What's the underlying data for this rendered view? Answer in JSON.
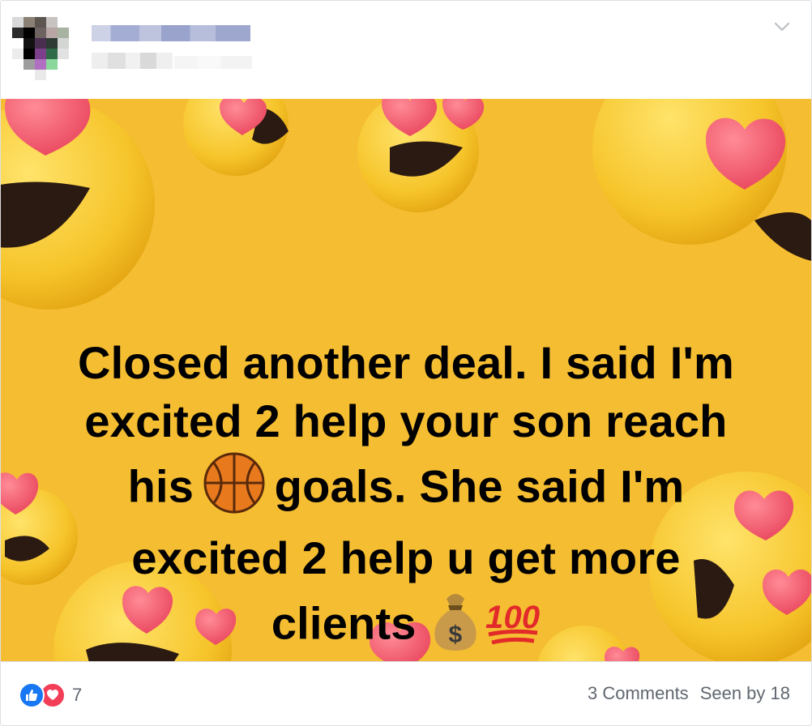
{
  "post": {
    "author_name": "",
    "caption_lines": [
      "Closed another deal. I said I'm",
      "excited 2 help your son reach",
      "his",
      "goals. She said I'm",
      "excited 2 help u get more",
      "clients"
    ],
    "emojis": {
      "basketball": "basketball-emoji",
      "money_bag": "money-bag-emoji",
      "hundred": "hundred-points-emoji"
    }
  },
  "footer": {
    "reaction_icons": [
      "like-icon",
      "love-icon"
    ],
    "reaction_count": "7",
    "comments": "3 Comments",
    "seen_by": "Seen by 18"
  },
  "colors": {
    "image_background": "#f5bd31",
    "emoji_face": "#f7c52b",
    "heart": "#f45a6b",
    "like_blue": "#1877f2",
    "love_red": "#f33e58",
    "meta_text": "#606770"
  }
}
